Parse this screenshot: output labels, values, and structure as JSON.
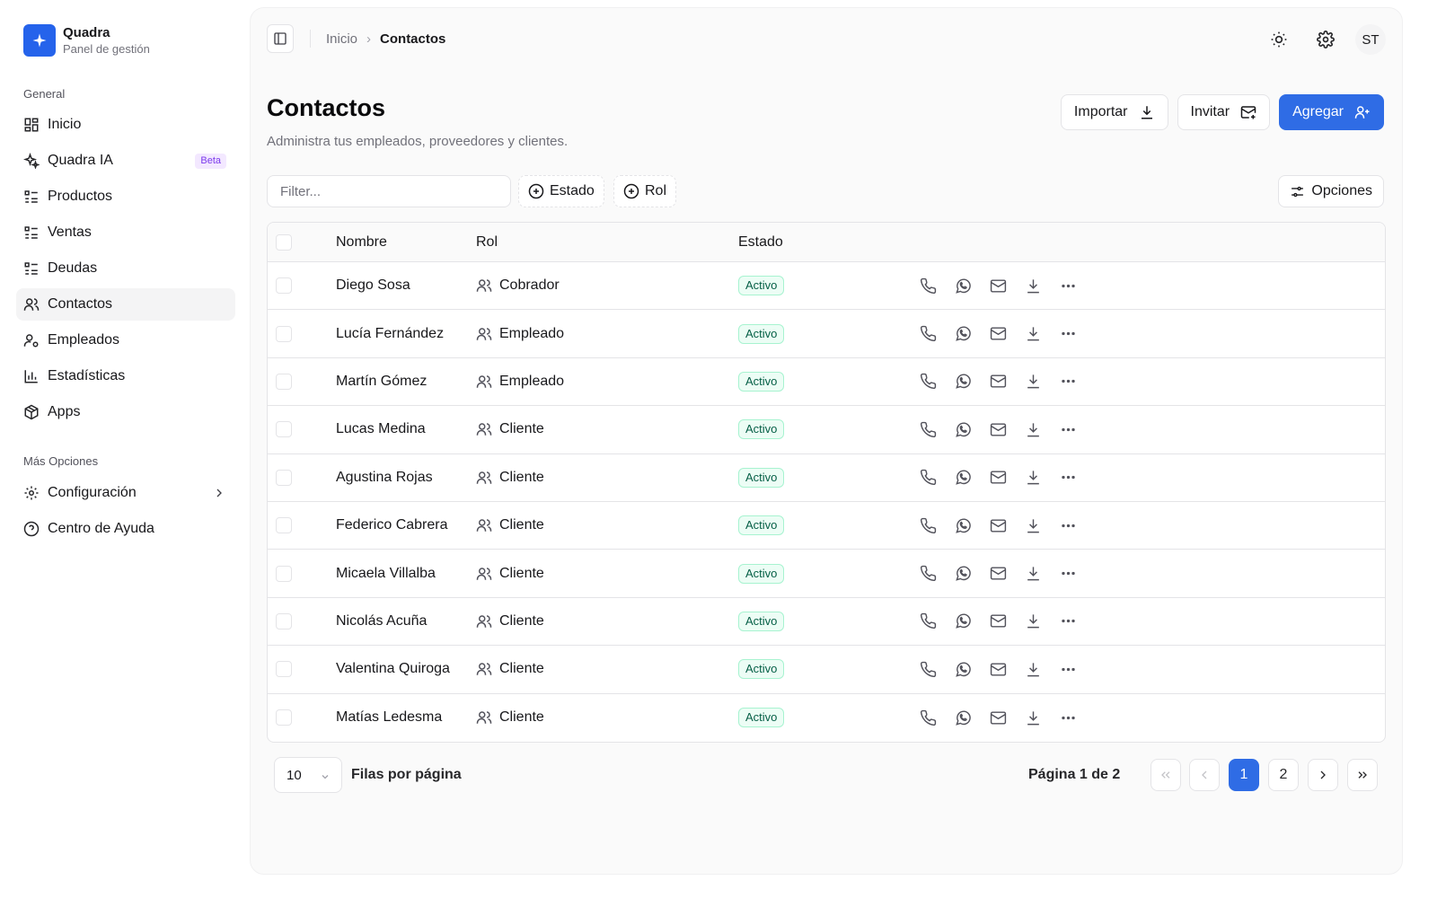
{
  "brand": {
    "name": "Quadra",
    "subtitle": "Panel de gestión"
  },
  "sidebar": {
    "section_general": "General",
    "items": [
      {
        "label": "Inicio",
        "icon": "dashboard-icon"
      },
      {
        "label": "Quadra IA",
        "icon": "sparkles-icon",
        "badge": "Beta"
      },
      {
        "label": "Productos",
        "icon": "list-icon"
      },
      {
        "label": "Ventas",
        "icon": "list-icon"
      },
      {
        "label": "Deudas",
        "icon": "list-icon"
      },
      {
        "label": "Contactos",
        "icon": "users-icon",
        "active": true
      },
      {
        "label": "Empleados",
        "icon": "user-cog-icon"
      },
      {
        "label": "Estadísticas",
        "icon": "bar-chart-icon"
      },
      {
        "label": "Apps",
        "icon": "package-icon"
      }
    ],
    "section_more": "Más Opciones",
    "more_items": [
      {
        "label": "Configuración",
        "icon": "gear-icon"
      },
      {
        "label": "Centro de Ayuda",
        "icon": "help-circle-icon"
      }
    ]
  },
  "topbar": {
    "breadcrumb_home": "Inicio",
    "breadcrumb_sep": "›",
    "breadcrumb_current": "Contactos",
    "avatar_initials": "ST"
  },
  "page": {
    "title": "Contactos",
    "subtitle": "Administra tus empleados, proveedores y clientes."
  },
  "actions": {
    "import": "Importar",
    "invite": "Invitar",
    "add": "Agregar"
  },
  "filters": {
    "placeholder": "Filter...",
    "status": "Estado",
    "role": "Rol",
    "options": "Opciones"
  },
  "table": {
    "headers": {
      "name": "Nombre",
      "role": "Rol",
      "status": "Estado"
    },
    "rows": [
      {
        "name": "Diego Sosa",
        "role": "Cobrador",
        "status": "Activo"
      },
      {
        "name": "Lucía Fernández",
        "role": "Empleado",
        "status": "Activo"
      },
      {
        "name": "Martín Gómez",
        "role": "Empleado",
        "status": "Activo"
      },
      {
        "name": "Lucas Medina",
        "role": "Cliente",
        "status": "Activo"
      },
      {
        "name": "Agustina Rojas",
        "role": "Cliente",
        "status": "Activo"
      },
      {
        "name": "Federico Cabrera",
        "role": "Cliente",
        "status": "Activo"
      },
      {
        "name": "Micaela Villalba",
        "role": "Cliente",
        "status": "Activo"
      },
      {
        "name": "Nicolás Acuña",
        "role": "Cliente",
        "status": "Activo"
      },
      {
        "name": "Valentina Quiroga",
        "role": "Cliente",
        "status": "Activo"
      },
      {
        "name": "Matías Ledesma",
        "role": "Cliente",
        "status": "Activo"
      }
    ]
  },
  "pagination": {
    "rows_per_page_value": "10",
    "rows_per_page_label": "Filas por página",
    "page_info": "Página 1 de 2",
    "pages": [
      "1",
      "2"
    ],
    "current_page": "1"
  },
  "colors": {
    "accent": "#2f6ce5",
    "status_active_bg": "#ecfdf5",
    "status_active_text": "#065f46"
  }
}
